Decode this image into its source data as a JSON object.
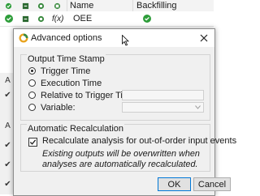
{
  "grid": {
    "columns": [
      "Name",
      "Backfilling"
    ],
    "row": {
      "name": "OEE",
      "fx_label": "f(x)"
    }
  },
  "side_strip": {
    "items": [
      "A",
      "✔",
      "A",
      "✔",
      "✔",
      "✔"
    ]
  },
  "dialog": {
    "title": "Advanced options",
    "output_group": {
      "title": "Output Time Stamp",
      "options": [
        {
          "label": "Trigger Time",
          "selected": true
        },
        {
          "label": "Execution Time",
          "selected": false
        },
        {
          "label": "Relative to Trigger Time:",
          "selected": false
        },
        {
          "label": "Variable:",
          "selected": false
        }
      ],
      "relative_value": "",
      "variable_value": ""
    },
    "recalc_group": {
      "title": "Automatic Recalculation",
      "checkbox_label": "Recalculate analysis for out-of-order input events",
      "checked": true,
      "note": "Existing outputs will be overwritten when analyses are automatically recalculated."
    },
    "buttons": {
      "ok": "OK",
      "cancel": "Cancel"
    }
  },
  "colors": {
    "accent": "#0078d7",
    "success": "#2e9d3a",
    "dialog_bg": "#f0f0f0"
  }
}
